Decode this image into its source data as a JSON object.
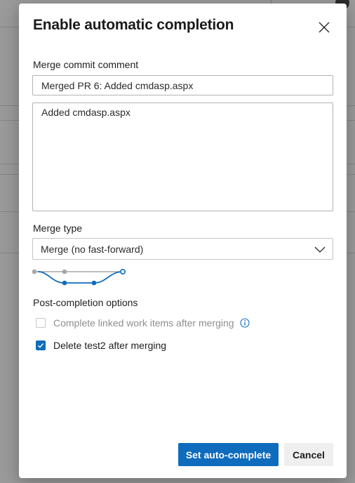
{
  "dialog": {
    "title": "Enable automatic completion",
    "close_icon": "close-icon"
  },
  "merge_commit": {
    "label": "Merge commit comment",
    "title_value": "Merged PR 6: Added cmdasp.aspx",
    "description_value": "Added cmdasp.aspx"
  },
  "merge_type": {
    "label": "Merge type",
    "selected": "Merge (no fast-forward)",
    "chevron_icon": "chevron-down-icon"
  },
  "post_completion": {
    "label": "Post-completion options",
    "options": [
      {
        "label": "Complete linked work items after merging",
        "checked": false,
        "disabled": true,
        "icon": "info-icon"
      },
      {
        "label": "Delete test2 after merging",
        "checked": true,
        "disabled": false
      }
    ]
  },
  "actions": {
    "primary_label": "Set auto-complete",
    "cancel_label": "Cancel"
  },
  "colors": {
    "accent": "#0f6cbd",
    "graph_gray": "#a6a6a6"
  }
}
